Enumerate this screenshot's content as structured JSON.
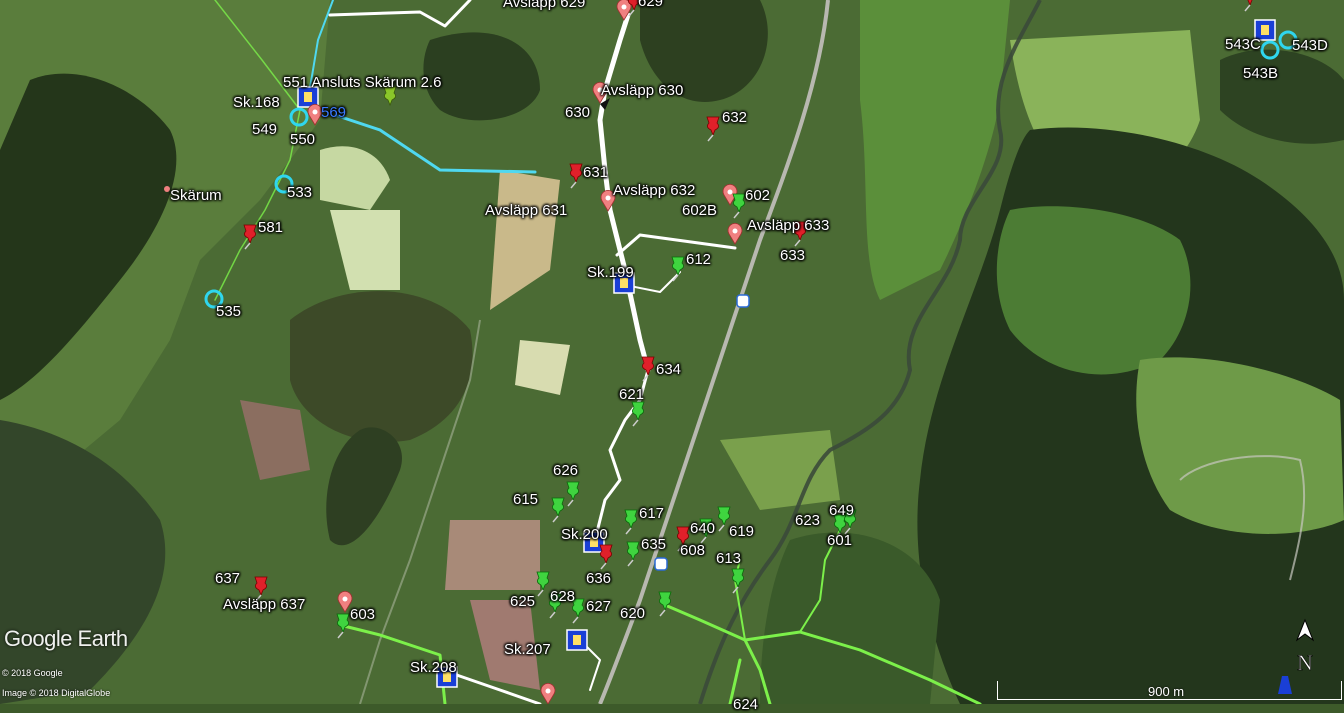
{
  "labels": {
    "l551": "551 Ansluts Skärum 2.6",
    "sk168": "Sk.168",
    "l569": "569",
    "l549": "549",
    "l550": "550",
    "skarum": "Skärum",
    "l533": "533",
    "l581": "581",
    "l535": "535",
    "avs629": "Avsläpp 629",
    "l629": "629",
    "avs630": "Avsläpp 630",
    "l630": "630",
    "l632": "632",
    "l631": "631",
    "avs632": "Avsläpp 632",
    "l602": "602",
    "avs631": "Avsläpp 631",
    "l602b": "602B",
    "avs633": "Avsläpp 633",
    "l633": "633",
    "sk199": "Sk.199",
    "l612": "612",
    "l634": "634",
    "l621": "621",
    "l626": "626",
    "l615": "615",
    "l617": "617",
    "sk200": "Sk.200",
    "l640": "640",
    "l619": "619",
    "l623": "623",
    "l649": "649",
    "l601": "601",
    "l635": "635",
    "l608": "608",
    "l613": "613",
    "l636": "636",
    "l637": "637",
    "avs637": "Avsläpp 637",
    "l603": "603",
    "l625": "625",
    "l628": "628",
    "l627": "627",
    "l620": "620",
    "sk207": "Sk.207",
    "sk208": "Sk.208",
    "l543c": "543C",
    "l543d": "543D",
    "l543b": "543B",
    "l624": "624"
  },
  "attribution": {
    "watermark": "Google Earth",
    "credit1": "© 2018 Google",
    "credit2": "Image © 2018 DigitalGlobe"
  },
  "scale": {
    "label": "900 m"
  },
  "north": {
    "label": "N"
  },
  "colors": {
    "pin_red": "#e0202a",
    "pin_green": "#3fd43f",
    "pin_yellowgreen": "#8ac62a",
    "pin_black": "#111111",
    "circle_cyan": "#2fd6ee",
    "avslapp_pink": "#f08080",
    "route_white": "#ffffff",
    "route_cyan": "#4fd8f0",
    "route_green": "#7cf04a",
    "square_blue": "#1a3fd6"
  }
}
